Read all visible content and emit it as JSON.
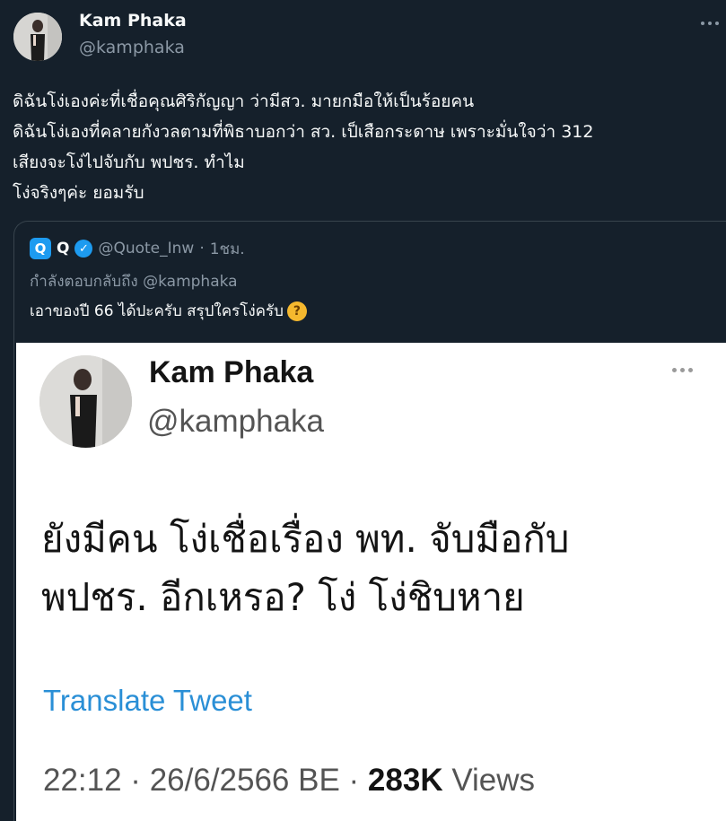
{
  "tweet": {
    "author_name": "Kam Phaka",
    "author_handle": "@kamphaka",
    "text": "ดิฉันโง่เองค่ะที่เชื่อคุณศิริกัญญา ว่ามีสว. มายกมือให้เป็นร้อยคน\nดิฉันโง่เองที่คลายกังวลตามที่พิธาบอกว่า สว. เป็เสือกระดาษ เพราะมั่นใจว่า 312\nเสียงจะโง่ไปจับกับ พปชร. ทำไม\nโง่จริงๆค่ะ ยอมรับ"
  },
  "quote": {
    "name": "Q",
    "logo_letter": "Q",
    "handle": "@Quote_Inw",
    "separator": "·",
    "time": "1ชม.",
    "reply_prefix": "กำลังตอบกลับถึง",
    "reply_handle": "@kamphaka",
    "text": "เอาของปี 66 ได้ปะครับ สรุปใครโง่ครับ",
    "emoji": "thinking-face",
    "screenshot": {
      "author_name": "Kam Phaka",
      "author_handle": "@kamphaka",
      "text": "ยังมีคน โง่เชื่อเรื่อง พท. จับมือกับ\nพปชร. อีกเหรอ? โง่ โง่ชิบหาย",
      "translate_label": "Translate Tweet",
      "timestamp": "22:12 · 26/6/2566 BE · ",
      "views_count": "283K",
      "views_label": " Views"
    }
  },
  "colors": {
    "background": "#15202b",
    "accent": "#1d9bf0",
    "muted": "#8b98a5"
  }
}
